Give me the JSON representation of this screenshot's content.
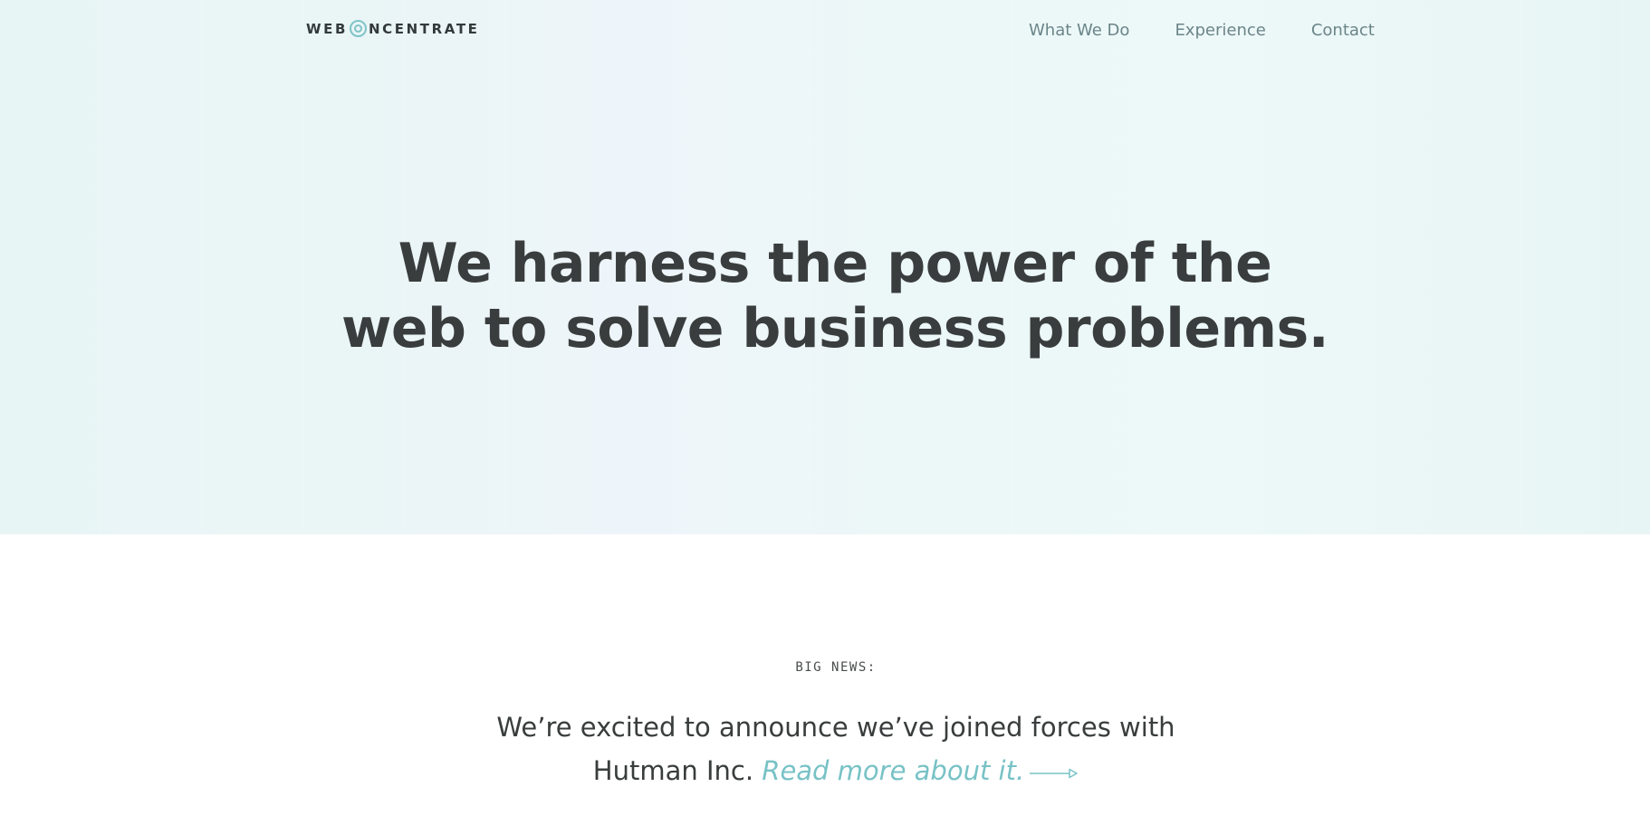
{
  "brand": {
    "logo_left": "WEB",
    "logo_right": "NCENTRATE"
  },
  "nav": {
    "items": [
      "What We Do",
      "Experience",
      "Contact"
    ]
  },
  "hero": {
    "headline_line1": "We harness the power of the",
    "headline_line2": "web to solve business problems."
  },
  "news": {
    "label": "BIG NEWS:",
    "text_line1": "We’re excited to announce we’ve joined forces with",
    "text_line2": "Hutman Inc.",
    "link_text": "Read more about it."
  },
  "colors": {
    "accent": "#78c2c6",
    "text_dark": "#3a3d3d",
    "nav_text": "#6b8589",
    "hero_bg": "#eaf6f6"
  },
  "icons": {
    "logo": "concentric-circles-icon",
    "link_arrow": "arrow-right-icon"
  }
}
